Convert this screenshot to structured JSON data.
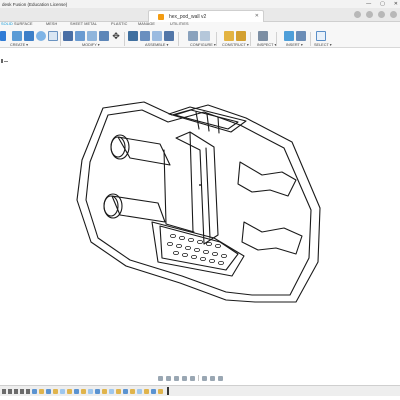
{
  "window": {
    "title": "desk Fusion (Education License)",
    "controls": [
      "—",
      "▢",
      "✕"
    ]
  },
  "document_tab": {
    "label": "hex_pod_wall v2",
    "close": "✕"
  },
  "ribbon_tabs": [
    "SOLID",
    "SURFACE",
    "MESH",
    "SHEET METAL",
    "PLASTIC",
    "MANAGE",
    "UTILITIES"
  ],
  "ribbon_groups": [
    "CREATE ▾",
    "MODIFY ▾",
    "ASSEMBLE ▾",
    "CONFIGURE ▾",
    "CONSTRUCT ▾",
    "INSPECT ▾",
    "INSERT ▾",
    "SELECT ▾"
  ],
  "colors": {
    "accent": "#0696d7",
    "create_blue": "#2f7bd6",
    "timeline_step": "#e0b44c"
  },
  "icons": {
    "new_component": "new-component-icon",
    "extrude": "extrude-icon",
    "revolve": "revolve-icon",
    "fillet": "fillet-icon",
    "move": "move-icon",
    "plane": "construct-plane-icon",
    "measure": "measure-icon",
    "insert_image": "insert-image-icon",
    "select": "select-icon"
  }
}
